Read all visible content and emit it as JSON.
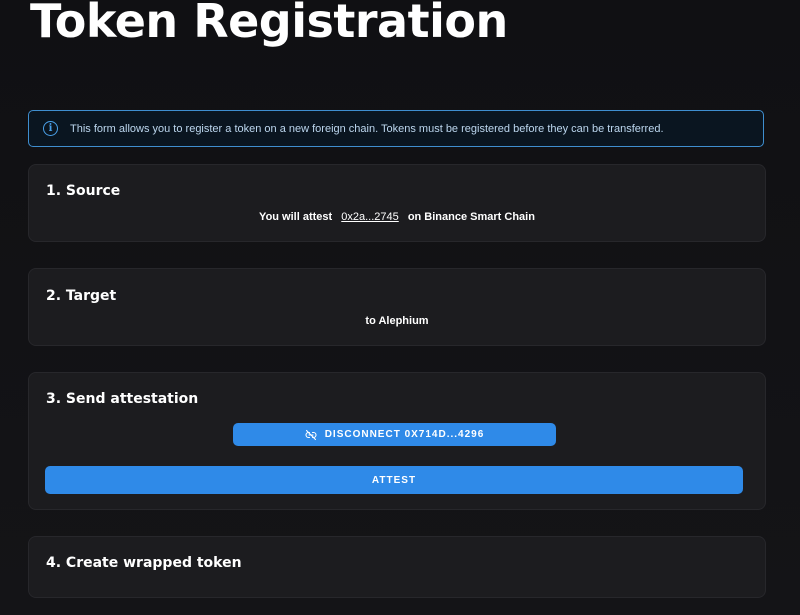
{
  "page": {
    "title": "Token Registration"
  },
  "info_banner": {
    "icon": "info-icon",
    "text": "This form allows you to register a token on a new foreign chain. Tokens must be registered before they can be transferred."
  },
  "steps": {
    "source": {
      "title": "1. Source",
      "prefix": "You will attest",
      "token": "0x2a...2745",
      "suffix": "on Binance Smart Chain"
    },
    "target": {
      "title": "2. Target",
      "text": "to Alephium"
    },
    "send_attestation": {
      "title": "3. Send attestation",
      "disconnect_icon": "link-off-icon",
      "disconnect_label": "DISCONNECT 0X714D...4296",
      "attest_label": "ATTEST"
    },
    "create_wrapped": {
      "title": "4. Create wrapped token"
    }
  },
  "colors": {
    "accent": "#2f8ae8",
    "banner_border": "#3f8ecf",
    "card_bg": "#1c1c1f",
    "page_bg": "#131316"
  }
}
